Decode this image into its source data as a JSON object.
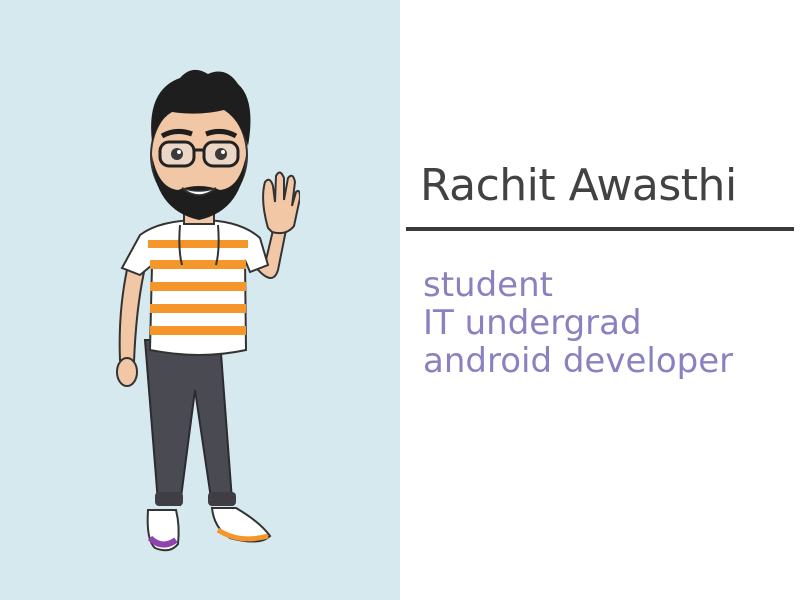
{
  "profile": {
    "name": "Rachit Awasthi",
    "roles": [
      "student",
      "IT undergrad",
      "android developer"
    ]
  },
  "avatar": {
    "icon": "waving-cartoon-avatar"
  },
  "colors": {
    "left_background": "#d6e9ee",
    "right_background": "#ffffff",
    "name_text": "#424242",
    "underline": "#3a3a3a",
    "role_text": "#8a82c0",
    "shirt_stripe": "#f5962a",
    "pants": "#4a4a52"
  }
}
